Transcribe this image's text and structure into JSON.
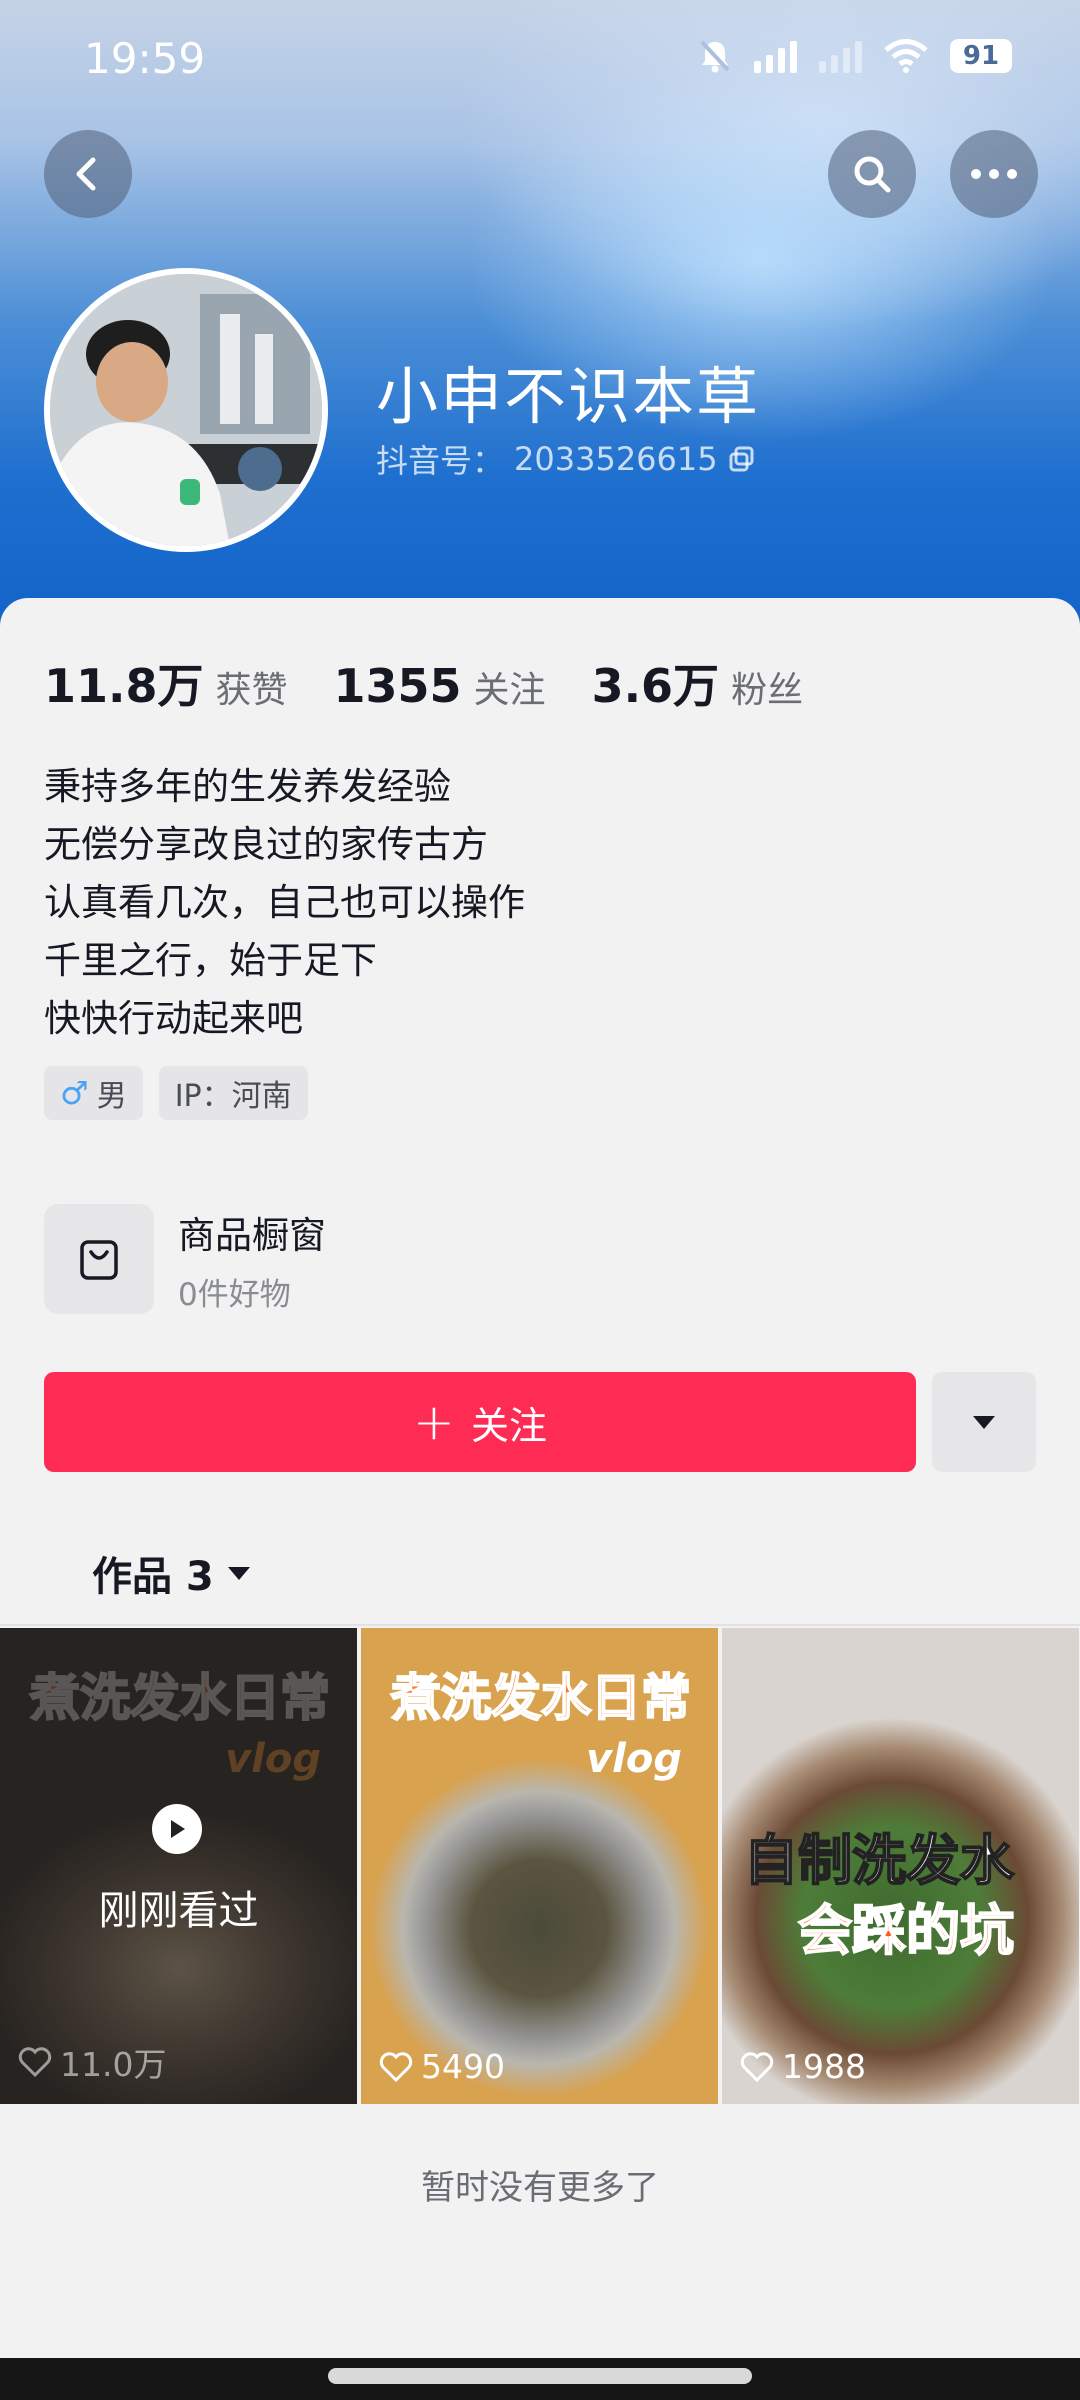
{
  "status_bar": {
    "time": "19:59",
    "battery": "91"
  },
  "profile": {
    "nickname": "小申不识本草",
    "douyin_id_label": "抖音号：",
    "douyin_id": "2033526615"
  },
  "stats": [
    {
      "value": "11.8万",
      "label": "获赞"
    },
    {
      "value": "1355",
      "label": "关注"
    },
    {
      "value": "3.6万",
      "label": "粉丝"
    }
  ],
  "bio": [
    "秉持多年的生发养发经验",
    "无偿分享改良过的家传古方",
    "认真看几次，自己也可以操作",
    "千里之行，始于足下",
    "快快行动起来吧"
  ],
  "tags": {
    "gender": "男",
    "ip": "IP：河南"
  },
  "shop": {
    "title": "商品橱窗",
    "subtitle": "0件好物"
  },
  "follow": {
    "label": "关注",
    "accent": "#fe2c55"
  },
  "works": {
    "label": "作品 3"
  },
  "videos": [
    {
      "title": "煮洗发水日常",
      "tag": "vlog",
      "status": "刚刚看过",
      "likes": "11.0万"
    },
    {
      "title": "煮洗发水日常",
      "tag": "vlog",
      "likes": "5490"
    },
    {
      "title_line1": "自制洗发水",
      "title_line2": "会踩的坑",
      "likes": "1988"
    }
  ],
  "footer": {
    "no_more": "暂时没有更多了"
  }
}
